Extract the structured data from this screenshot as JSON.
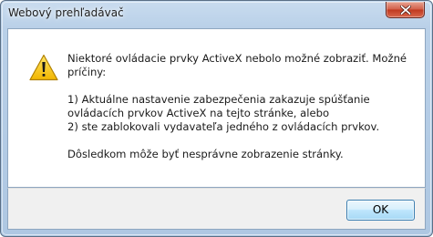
{
  "window": {
    "title": "Webový prehľadávač",
    "close_icon": "close-x-icon"
  },
  "message": {
    "icon": "warning-icon",
    "line1": "Niektoré ovládacie prvky ActiveX nebolo možné zobraziť. Možné príčiny:",
    "reason1": "1) Aktuálne nastavenie zabezpečenia zakazuje spúšťanie ovládacích prvkov ActiveX na tejto stránke, alebo",
    "reason2": "2) ste zablokovali vydavateľa jedného z ovládacích prvkov.",
    "consequence": "Dôsledkom môže byť nesprávne zobrazenie stránky."
  },
  "buttons": {
    "ok_label": "OK"
  },
  "colors": {
    "close_button": "#c8432a",
    "ok_button_border": "#3c7fb1",
    "warning_yellow": "#f5c400"
  }
}
